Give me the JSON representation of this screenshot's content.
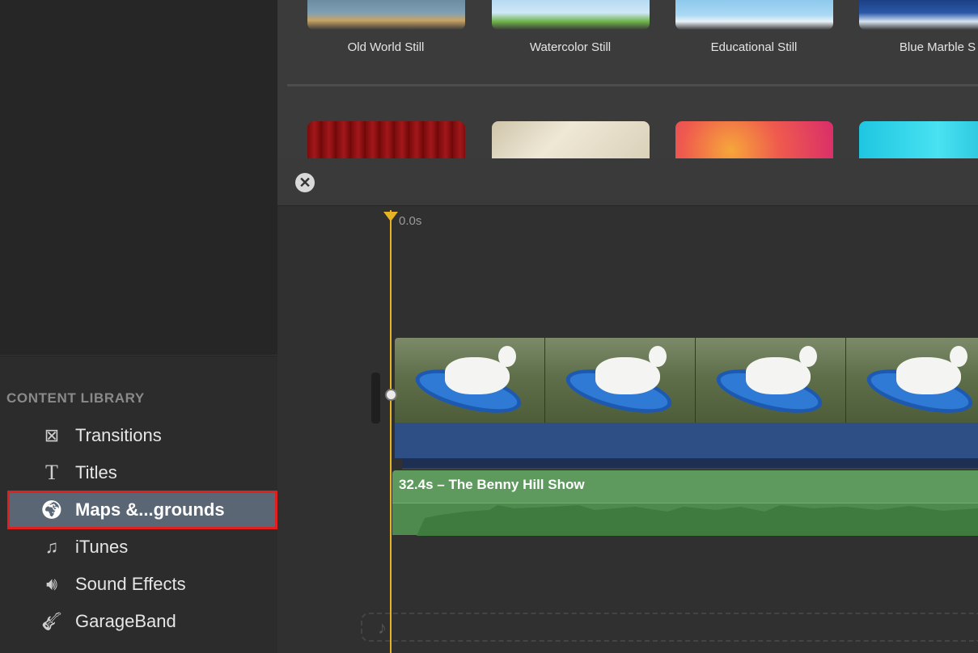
{
  "library": {
    "header": "CONTENT LIBRARY",
    "items": [
      {
        "label": "Transitions",
        "icon": "transitions-icon",
        "glyph": "⊠"
      },
      {
        "label": "Titles",
        "icon": "titles-icon",
        "glyph": "T"
      },
      {
        "label": "Maps &...grounds",
        "icon": "globe-icon",
        "glyph": "🌍︎",
        "selected": true
      },
      {
        "label": "iTunes",
        "icon": "music-note-icon",
        "glyph": "♫"
      },
      {
        "label": "Sound Effects",
        "icon": "speaker-icon",
        "glyph": "🔊︎"
      },
      {
        "label": "GarageBand",
        "icon": "guitar-icon",
        "glyph": "🎸︎"
      }
    ]
  },
  "browser": {
    "row1": [
      {
        "label": "Old World Still",
        "color": "#6f8fa5"
      },
      {
        "label": "Watercolor Still",
        "color": "#9cc9e8"
      },
      {
        "label": "Educational Still",
        "color": "#8cc7ea"
      },
      {
        "label": "Blue Marble S",
        "color": "#1d3e84"
      }
    ],
    "row2": [
      {
        "name": "curtain-background",
        "color": "#8a0f10"
      },
      {
        "name": "parchment-background",
        "color": "#e3dccb"
      },
      {
        "name": "bokeh-background",
        "color": "#e43a5a"
      },
      {
        "name": "cyan-background",
        "color": "#2bd2e8"
      }
    ]
  },
  "timeline": {
    "close_glyph": "✕",
    "playhead_time": "0.0s",
    "music_clip_label": "32.4s – The Benny Hill Show",
    "music_drop_glyph": "♪",
    "colors": {
      "playhead": "#e6b422",
      "audio_blue": "#2d4f86",
      "music_green": "#5e9a5e",
      "selection_outline": "#e0201e"
    }
  }
}
